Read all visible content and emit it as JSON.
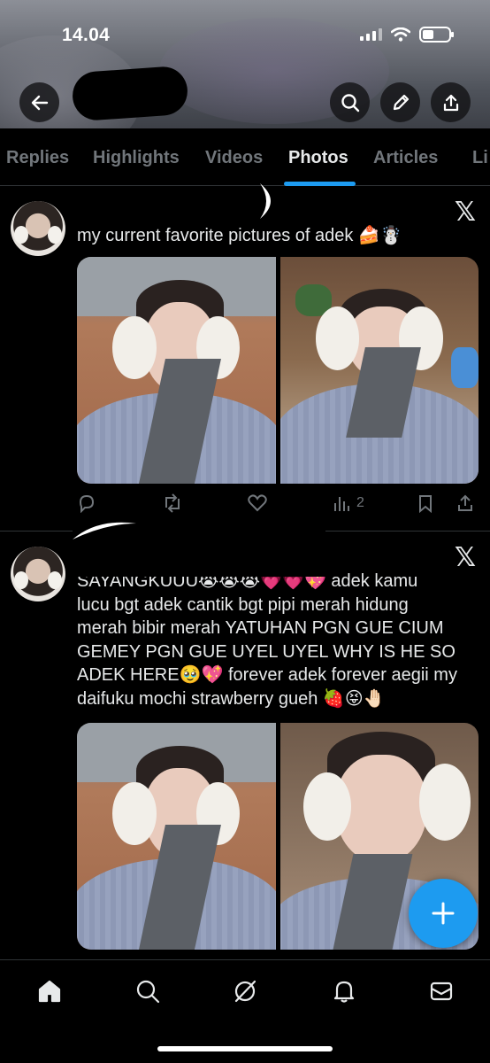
{
  "status_bar": {
    "time": "14.04"
  },
  "tabs": [
    {
      "label": "Replies",
      "active": false
    },
    {
      "label": "Highlights",
      "active": false
    },
    {
      "label": "Videos",
      "active": false
    },
    {
      "label": "Photos",
      "active": true
    },
    {
      "label": "Articles",
      "active": false
    },
    {
      "label": "Li",
      "active": false
    }
  ],
  "posts": [
    {
      "text": "my current favorite pictures of adek 🍰☃️",
      "source_logo": "𝕏",
      "views": "2",
      "photos": [
        "photo-1",
        "photo-2"
      ]
    },
    {
      "text_lines": [
        "SAYANGKUUU😭😭😭💗💗💖 adek kamu",
        "lucu bgt adek cantik bgt pipi merah hidung",
        "merah bibir merah YATUHAN PGN GUE CIUM",
        "GEMEY PGN GUE UYEL UYEL WHY IS HE SO",
        "ADEK HERE🥹💖 forever adek forever aegii my",
        "daifuku mochi strawberry gueh 🍓😝🤚🏻"
      ],
      "source_logo": "𝕏",
      "photos": [
        "photo-3",
        "photo-4"
      ]
    }
  ],
  "icons": {
    "back": "back-arrow-icon",
    "search": "search-icon",
    "edit": "pencil-icon",
    "share": "share-icon",
    "reply": "reply-icon",
    "repost": "repost-icon",
    "like": "heart-icon",
    "views": "views-icon",
    "bookmark": "bookmark-icon",
    "compose": "plus-icon"
  },
  "colors": {
    "accent": "#1d9bf0",
    "text": "#e7e9ea",
    "muted": "#71767b",
    "divider": "#2f3336"
  }
}
